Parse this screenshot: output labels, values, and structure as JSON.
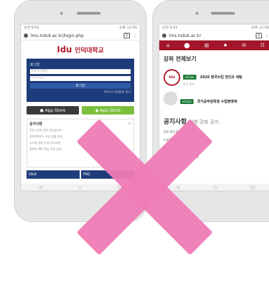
{
  "left_phone": {
    "status": {
      "left": "오전 9:41",
      "right": "오후 12:00"
    },
    "url": "lms.induk.ac.kr/login.php",
    "tab_count": "1",
    "logo": {
      "mark": "Idu",
      "name": "인덕대학교"
    },
    "login": {
      "title": "로그인",
      "id_placeholder": "아이디 (학번)",
      "pw_placeholder": "••••••••",
      "button": "로그인",
      "links": "아이디 | 비밀번호 찾기"
    },
    "stores": [
      {
        "label": "App Store",
        "icon": "apple-icon"
      },
      {
        "label": "App Store",
        "icon": "android-icon"
      }
    ],
    "notice": {
      "title": "공지사항",
      "lines": [
        "1학기 강의 공지 안내입니다",
        "2020학년도 수업 진행 안내",
        "시스템 점검 안내 공지사항",
        "2020 LMS 학습 이용 안내"
      ]
    },
    "bottom_tabs": [
      "Q&A",
      "FAQ"
    ]
  },
  "right_phone": {
    "status": {
      "left": "오전 9:41",
      "right": "오후 12:00"
    },
    "url": "lms.induk.ac.kr",
    "tab_count": "1",
    "section_title": "강좌 전체보기",
    "courses": [
      {
        "badge": "eClass",
        "title": "2020 영국수업 전인조 세팅",
        "sub": "학기 강의"
      },
      {
        "badge": "eClass",
        "title": "국가공무원학생 수업편대에",
        "sub": ""
      }
    ],
    "notice_title": "공지사항",
    "notice_subtitle": "진행 강좌 공지",
    "notice_lines": [
      "공지 강의 진행 안내 (학기)",
      "수업진행 및 유의사항 안내",
      "활동 수업 안내 확인 요청 사항",
      "강좌 평가 및 강의 자료실 공지"
    ]
  },
  "overlay": {
    "symbol": "cross-mark",
    "color": "#ee7bb4"
  }
}
